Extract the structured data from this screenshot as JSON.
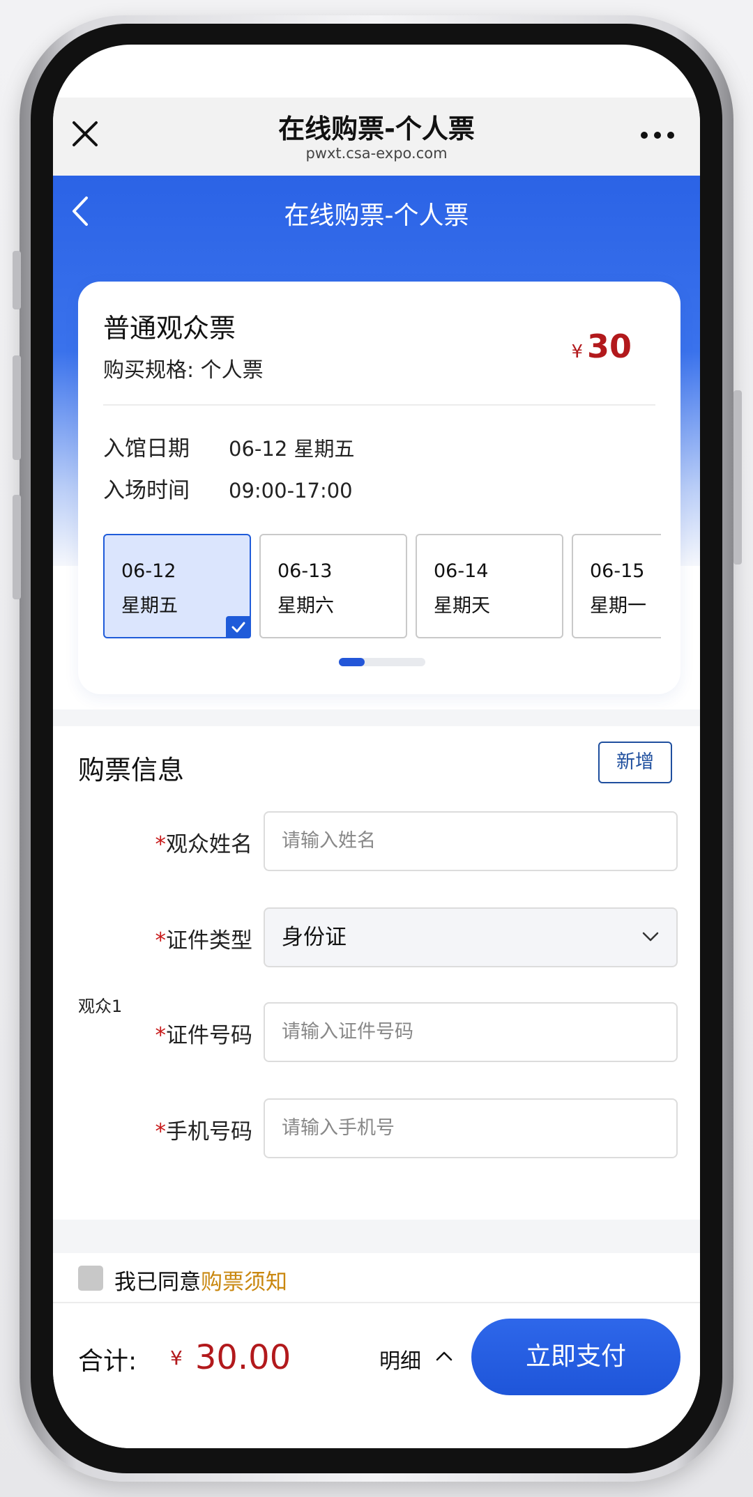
{
  "wechat_bar": {
    "title": "在线购票-个人票",
    "url": "pwxt.csa-expo.com"
  },
  "header": {
    "title": "在线购票-个人票"
  },
  "ticket": {
    "name": "普通观众票",
    "spec": "购买规格: 个人票",
    "currency": "¥",
    "price": "30",
    "entry_date_label": "入馆日期",
    "entry_date_value": "06-12 星期五",
    "entry_time_label": "入场时间",
    "entry_time_value": "09:00-17:00",
    "dates": [
      {
        "date": "06-12",
        "weekday": "星期五",
        "selected": true
      },
      {
        "date": "06-13",
        "weekday": "星期六",
        "selected": false
      },
      {
        "date": "06-14",
        "weekday": "星期天",
        "selected": false
      },
      {
        "date": "06-15",
        "weekday": "星期一",
        "selected": false
      }
    ],
    "pager_progress": 0.3
  },
  "purchase_info": {
    "title": "购票信息",
    "add_label": "新增",
    "viewer_label": "观众1",
    "required_mark": "*",
    "fields": {
      "name": {
        "label": "观众姓名",
        "placeholder": "请输入姓名"
      },
      "id_type": {
        "label": "证件类型",
        "value": "身份证"
      },
      "id_number": {
        "label": "证件号码",
        "placeholder": "请输入证件号码"
      },
      "phone": {
        "label": "手机号码",
        "placeholder": "请输入手机号"
      }
    }
  },
  "agreement": {
    "prefix": "我已同意",
    "link": "购票须知"
  },
  "footer": {
    "total_label": "合计:",
    "currency": "¥",
    "total_value": "30.00",
    "detail_label": "明细",
    "pay_label": "立即支付"
  },
  "colors": {
    "brand_blue": "#2b63e6",
    "price_red": "#b2191c",
    "link_gold": "#c9870f"
  }
}
